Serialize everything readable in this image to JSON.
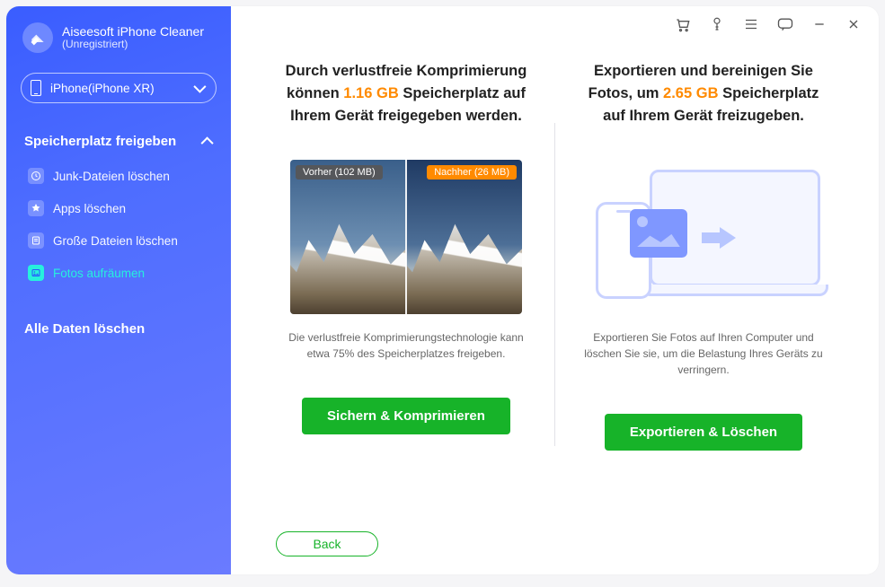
{
  "brand": {
    "name": "Aiseesoft iPhone Cleaner",
    "status": "(Unregistriert)"
  },
  "device": {
    "label": "iPhone(iPhone XR)"
  },
  "sidebar": {
    "section_title": "Speicherplatz freigeben",
    "items": [
      {
        "label": "Junk-Dateien löschen",
        "icon": "clock-icon"
      },
      {
        "label": "Apps löschen",
        "icon": "app-icon"
      },
      {
        "label": "Große Dateien löschen",
        "icon": "file-icon"
      },
      {
        "label": "Fotos aufräumen",
        "icon": "photo-icon"
      }
    ],
    "erase_label": "Alle Daten löschen"
  },
  "panels": {
    "compress": {
      "head_pre": "Durch verlustfreie Komprimierung können ",
      "head_hl": "1.16 GB",
      "head_post": " Speicherplatz auf Ihrem Gerät freigegeben werden.",
      "badge_before": "Vorher (102 MB)",
      "badge_after": "Nachher (26 MB)",
      "caption": "Die verlustfreie Komprimierungstechnologie kann etwa 75% des Speicherplatzes freigeben.",
      "cta": "Sichern & Komprimieren"
    },
    "export": {
      "head_pre": "Exportieren und bereinigen Sie Fotos, um ",
      "head_hl": "2.65 GB",
      "head_post": " Speicherplatz auf Ihrem Gerät freizugeben.",
      "caption": "Exportieren Sie Fotos auf Ihren Computer und löschen Sie sie, um die Belastung Ihres Geräts zu verringern.",
      "cta": "Exportieren & Löschen"
    }
  },
  "back_label": "Back",
  "colors": {
    "accent": "#ff8a00",
    "primary_green": "#17b329",
    "sidebar_active": "#26f0dd"
  }
}
